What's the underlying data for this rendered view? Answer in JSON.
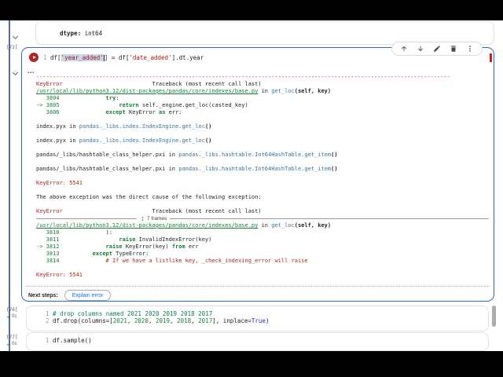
{
  "colors": {
    "accent_blue": "#2d6bc8",
    "error_red": "#b3261e",
    "path_green": "#188038",
    "link_blue": "#1a73e8"
  },
  "icons": {
    "run-icon": "play-triangle",
    "collapse-icon": "chevron-down",
    "move-up-icon": "arrow-up",
    "move-down-icon": "arrow-down",
    "edit-icon": "pencil",
    "delete-icon": "trash",
    "more-vert-icon": "kebab-dots",
    "expand-frames-icon": "unfold-arrows",
    "success-icon": "checkmark",
    "output-ellipsis-icon": "three-dots"
  },
  "prev_output": {
    "dtype_label": "dtype:",
    "dtype_value": " int64"
  },
  "cell72": {
    "exec_label": "[72]",
    "code_lines": [
      {
        "s": [
          [
            "ln",
            "1 "
          ],
          [
            "pl",
            "df["
          ],
          [
            "sel",
            "'year_added'"
          ],
          [
            "cur",
            ""
          ],
          [
            "pl",
            "] = df["
          ],
          [
            "st",
            "'date_added'"
          ],
          [
            "pl",
            "].dt.year"
          ]
        ]
      }
    ],
    "toolbar_icons": [
      "move-up",
      "move-down",
      "edit",
      "delete",
      "more-vert"
    ],
    "output_ellipsis": "...",
    "frames_label": "7 frames",
    "traceback": [
      {
        "s": [
          [
            "d",
            "-----------------------------------------------------------------------------------------------------------------------------"
          ]
        ]
      },
      {
        "s": [
          [
            "e",
            "KeyError"
          ],
          [
            "p",
            "                           Traceback (most recent call last)"
          ]
        ]
      },
      {
        "s": [
          [
            "g",
            "/usr/local/lib/python3.12/dist-packages/pandas/core/indexes/base.py"
          ],
          [
            "p",
            " in "
          ],
          [
            "f",
            "get_loc"
          ],
          [
            "b",
            "(self, key)"
          ]
        ]
      },
      {
        "s": [
          [
            "n",
            "   3804"
          ],
          [
            "p",
            "              "
          ],
          [
            "k",
            "try"
          ],
          [
            "p",
            ":"
          ]
        ]
      },
      {
        "s": [
          [
            "n",
            "-> 3805"
          ],
          [
            "p",
            "                  "
          ],
          [
            "k",
            "return"
          ],
          [
            "p",
            " self._engine.get_loc(casted_key)"
          ]
        ]
      },
      {
        "s": [
          [
            "n",
            "   3806"
          ],
          [
            "p",
            "              "
          ],
          [
            "k",
            "except"
          ],
          [
            "p",
            " KeyError "
          ],
          [
            "k",
            "as"
          ],
          [
            "p",
            " err:"
          ]
        ]
      },
      {
        "s": []
      },
      {
        "s": [
          [
            "p",
            "index.pyx"
          ],
          [
            "p",
            " in "
          ],
          [
            "f",
            "pandas._libs.index.IndexEngine.get_loc"
          ],
          [
            "b",
            "()"
          ]
        ]
      },
      {
        "s": []
      },
      {
        "s": [
          [
            "p",
            "index.pyx"
          ],
          [
            "p",
            " in "
          ],
          [
            "f",
            "pandas._libs.index.IndexEngine.get_loc"
          ],
          [
            "b",
            "()"
          ]
        ]
      },
      {
        "s": []
      },
      {
        "s": [
          [
            "p",
            "pandas/_libs/hashtable_class_helper.pxi"
          ],
          [
            "p",
            " in "
          ],
          [
            "f",
            "pandas._libs.hashtable.Int64HashTable.get_item"
          ],
          [
            "b",
            "()"
          ]
        ]
      },
      {
        "s": []
      },
      {
        "s": [
          [
            "p",
            "pandas/_libs/hashtable_class_helper.pxi"
          ],
          [
            "p",
            " in "
          ],
          [
            "f",
            "pandas._libs.hashtable.Int64HashTable.get_item"
          ],
          [
            "b",
            "()"
          ]
        ]
      },
      {
        "s": []
      },
      {
        "s": [
          [
            "e",
            "KeyError: 5541"
          ]
        ]
      },
      {
        "s": []
      },
      {
        "s": [
          [
            "p",
            "The above exception was the direct cause of the following exception:"
          ]
        ]
      },
      {
        "s": []
      },
      {
        "s": [
          [
            "e",
            "KeyError"
          ],
          [
            "p",
            "                           Traceback (most recent call last)"
          ]
        ]
      },
      {
        "div": true,
        "label": "7 frames"
      },
      {
        "s": [
          [
            "g",
            "/usr/local/lib/python3.12/dist-packages/pandas/core/indexes/base.py"
          ],
          [
            "p",
            " in "
          ],
          [
            "f",
            "get_loc"
          ],
          [
            "b",
            "(self, key)"
          ]
        ]
      },
      {
        "s": [
          [
            "n",
            "   3810"
          ],
          [
            "p",
            "              ):"
          ]
        ]
      },
      {
        "s": [
          [
            "n",
            "   3811"
          ],
          [
            "p",
            "                  "
          ],
          [
            "k",
            "raise"
          ],
          [
            "p",
            " InvalidIndexError(key)"
          ]
        ]
      },
      {
        "s": [
          [
            "n",
            "-> 3812"
          ],
          [
            "p",
            "              "
          ],
          [
            "k",
            "raise"
          ],
          [
            "p",
            " KeyError(key) "
          ],
          [
            "k",
            "from"
          ],
          [
            "p",
            " err"
          ]
        ]
      },
      {
        "s": [
          [
            "n",
            "   3813"
          ],
          [
            "p",
            "          "
          ],
          [
            "k",
            "except"
          ],
          [
            "p",
            " TypeError:"
          ]
        ]
      },
      {
        "s": [
          [
            "n",
            "   3814"
          ],
          [
            "p",
            "              "
          ],
          [
            "c",
            "# If we have a listlike key, _check_indexing_error will raise"
          ]
        ]
      },
      {
        "s": []
      },
      {
        "s": [
          [
            "e",
            "KeyError: 5541"
          ]
        ]
      }
    ],
    "next_steps_label": "Next steps:",
    "explain_button": "Explain error"
  },
  "cell76": {
    "exec_label": "[76]",
    "exec_time": "0s",
    "code_lines": [
      {
        "s": [
          [
            "ln",
            "1 "
          ],
          [
            "cm",
            "# drop columns named 2021 2020 2019 2018 2017"
          ]
        ]
      },
      {
        "s": [
          [
            "ln",
            "2 "
          ],
          [
            "pl",
            "df.drop(columns=["
          ],
          [
            "nu",
            "2021"
          ],
          [
            "pl",
            ", "
          ],
          [
            "nu",
            "2020"
          ],
          [
            "pl",
            ", "
          ],
          [
            "nu",
            "2019"
          ],
          [
            "pl",
            ", "
          ],
          [
            "nu",
            "2018"
          ],
          [
            "pl",
            ", "
          ],
          [
            "nu",
            "2017"
          ],
          [
            "pl",
            "], inplace="
          ],
          [
            "kw",
            "True"
          ],
          [
            "pl",
            ")"
          ]
        ]
      }
    ]
  },
  "cell77": {
    "exec_label": "[77]",
    "exec_time": "0s",
    "code_lines": [
      {
        "s": [
          [
            "ln",
            "1 "
          ],
          [
            "pl",
            "df.sample()"
          ]
        ]
      }
    ]
  }
}
